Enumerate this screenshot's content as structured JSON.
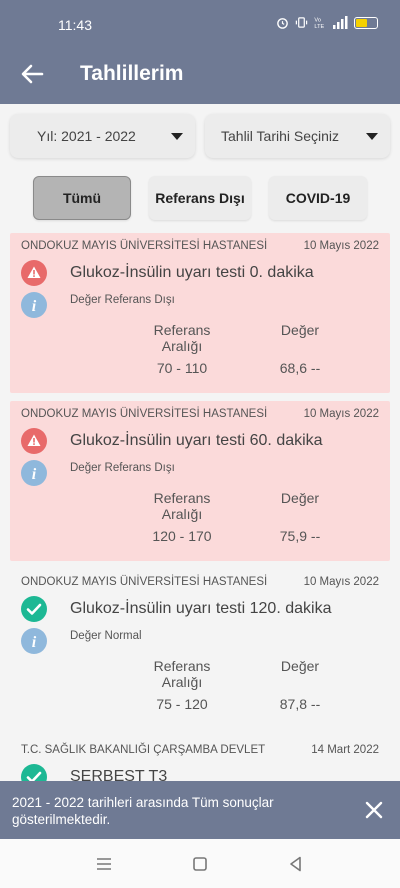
{
  "status_bar": {
    "time": "11:43",
    "icons": [
      "alarm-icon",
      "vibrate-icon",
      "volte-icon",
      "signal-icon",
      "battery-icon"
    ],
    "battery_color": "#f5d100"
  },
  "app_bar": {
    "title": "Tahlillerim",
    "back_icon": "arrow-left-icon",
    "background": "#6f7a94"
  },
  "filters": {
    "year_dropdown": "Yıl: 2021 - 2022",
    "date_dropdown": "Tahlil Tarihi Seçiniz",
    "tabs": [
      {
        "label": "Tümü",
        "active": true
      },
      {
        "label": "Referans Dışı",
        "active": false
      },
      {
        "label": "COVID-19",
        "active": false
      }
    ]
  },
  "results": [
    {
      "hospital": "ONDOKUZ MAYIS ÜNİVERSİTESİ HASTANESİ",
      "date": "10 Mayıs 2022",
      "test": "Glukoz-İnsülin uyarı testi 0. dakika",
      "status": "Değer Referans Dışı",
      "status_icon": "warning-icon",
      "range_header": "Referans Aralığı",
      "value_header": "Değer",
      "range": "70 - 110",
      "value": "68,6 --",
      "out_of_range": true
    },
    {
      "hospital": "ONDOKUZ MAYIS ÜNİVERSİTESİ HASTANESİ",
      "date": "10 Mayıs 2022",
      "test": "Glukoz-İnsülin uyarı testi 60. dakika",
      "status": "Değer Referans Dışı",
      "status_icon": "warning-icon",
      "range_header": "Referans Aralığı",
      "value_header": "Değer",
      "range": "120 - 170",
      "value": "75,9 --",
      "out_of_range": true
    },
    {
      "hospital": "ONDOKUZ MAYIS ÜNİVERSİTESİ HASTANESİ",
      "date": "10 Mayıs 2022",
      "test": "Glukoz-İnsülin uyarı testi 120. dakika",
      "status": "Değer Normal",
      "status_icon": "check-circle-icon",
      "range_header": "Referans Aralığı",
      "value_header": "Değer",
      "range": "75 - 120",
      "value": "87,8 --",
      "out_of_range": false
    },
    {
      "hospital": "T.C. SAĞLIK BAKANLIĞI ÇARŞAMBA DEVLET",
      "date": "14 Mart 2022",
      "test": "SERBEST T3",
      "status_icon": "check-circle-icon",
      "out_of_range": false
    }
  ],
  "snackbar": {
    "message": "2021 - 2022 tarihleri arasında Tüm sonuçlar gösterilmektedir.",
    "close_icon": "close-icon"
  },
  "colors": {
    "out_of_range_bg": "#fbdada",
    "warning_red": "#e86a6a",
    "check_green": "#1db894",
    "info_blue": "#8fb8dc",
    "active_tab": "#b4b4b4"
  }
}
